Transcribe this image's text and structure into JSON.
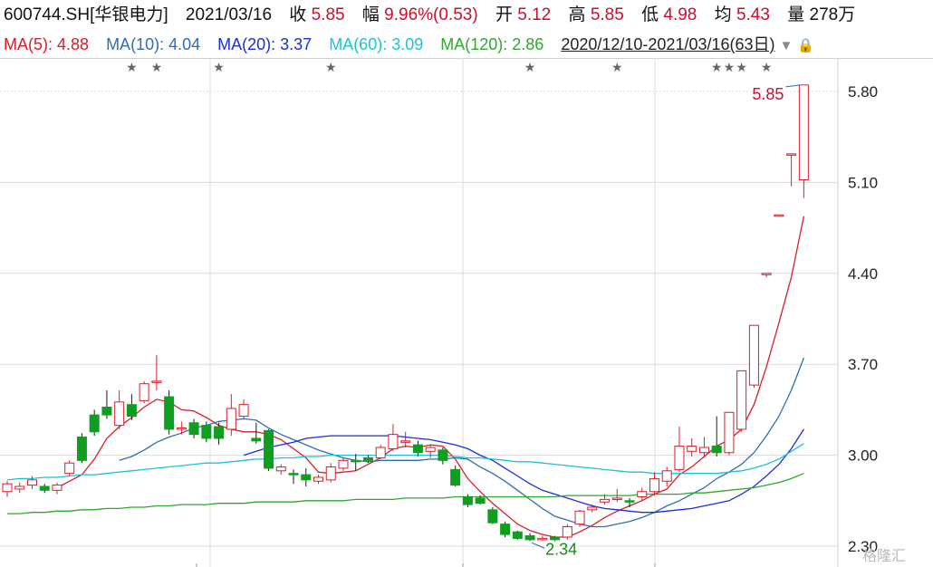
{
  "header": {
    "code": "600744.SH[华银电力]",
    "date": "2021/03/16",
    "close_label": "收",
    "close": "5.85",
    "change_label": "幅",
    "change": "9.96%(0.53)",
    "open_label": "开",
    "open": "5.12",
    "high_label": "高",
    "high": "5.85",
    "low_label": "低",
    "low": "4.98",
    "avg_label": "均",
    "avg": "5.43",
    "vol_label": "量",
    "vol": "278万"
  },
  "ma_bar": {
    "ma5": "MA(5): 4.88",
    "ma10": "MA(10): 4.04",
    "ma20": "MA(20): 3.37",
    "ma60": "MA(60): 3.09",
    "ma120": "MA(120): 2.86",
    "range": "2020/12/10-2021/03/16(63日)"
  },
  "watermark": "格隆汇",
  "colors": {
    "up": "#d81e2c",
    "down": "#0f9e20",
    "ma5": "#d81e2c",
    "ma10": "#2f6fb0",
    "ma20": "#1a2fd8",
    "ma60": "#1ec2d6",
    "ma120": "#2ea82e",
    "grid": "#dcdcdc"
  },
  "chart_data": {
    "type": "candlestick",
    "ylim": [
      2.3,
      5.8
    ],
    "y_ticks": [
      "5.80",
      "5.10",
      "4.40",
      "3.70",
      "3.00",
      "2.30"
    ],
    "annotations": {
      "high_label": "5.85",
      "low_label": "2.34"
    },
    "star_candles": [
      10,
      12,
      17,
      26,
      42,
      49,
      57,
      58,
      59,
      61
    ],
    "candles": [
      [
        2.72,
        2.78,
        2.68,
        2.8
      ],
      [
        2.74,
        2.76,
        2.71,
        2.79
      ],
      [
        2.77,
        2.81,
        2.74,
        2.84
      ],
      [
        2.76,
        2.73,
        2.71,
        2.78
      ],
      [
        2.73,
        2.77,
        2.7,
        2.79
      ],
      [
        2.86,
        2.94,
        2.84,
        2.96
      ],
      [
        3.14,
        2.96,
        2.94,
        3.17
      ],
      [
        3.31,
        3.18,
        3.15,
        3.35
      ],
      [
        3.37,
        3.31,
        3.28,
        3.5
      ],
      [
        3.23,
        3.41,
        3.2,
        3.5
      ],
      [
        3.39,
        3.3,
        3.27,
        3.47
      ],
      [
        3.42,
        3.55,
        3.4,
        3.57
      ],
      [
        3.56,
        3.57,
        3.5,
        3.77
      ],
      [
        3.45,
        3.2,
        3.16,
        3.5
      ],
      [
        3.2,
        3.21,
        3.16,
        3.26
      ],
      [
        3.25,
        3.16,
        3.13,
        3.28
      ],
      [
        3.23,
        3.13,
        3.1,
        3.26
      ],
      [
        3.22,
        3.13,
        3.08,
        3.25
      ],
      [
        3.2,
        3.36,
        3.15,
        3.47
      ],
      [
        3.3,
        3.39,
        3.28,
        3.43
      ],
      [
        3.13,
        3.11,
        3.09,
        3.25
      ],
      [
        3.19,
        2.9,
        2.88,
        3.2
      ],
      [
        2.88,
        2.91,
        2.85,
        2.93
      ],
      [
        2.86,
        2.85,
        2.78,
        2.89
      ],
      [
        2.85,
        2.81,
        2.76,
        2.9
      ],
      [
        2.8,
        2.83,
        2.78,
        2.85
      ],
      [
        2.81,
        2.91,
        2.79,
        2.94
      ],
      [
        2.9,
        2.96,
        2.88,
        2.98
      ],
      [
        2.96,
        2.95,
        2.88,
        3.01
      ],
      [
        2.98,
        2.96,
        2.94,
        3.0
      ],
      [
        2.98,
        3.06,
        2.97,
        3.08
      ],
      [
        3.05,
        3.16,
        3.03,
        3.24
      ],
      [
        3.1,
        3.11,
        3.06,
        3.18
      ],
      [
        3.08,
        3.02,
        2.99,
        3.11
      ],
      [
        3.03,
        3.06,
        2.98,
        3.08
      ],
      [
        3.04,
        2.96,
        2.93,
        3.06
      ],
      [
        2.89,
        2.77,
        2.76,
        2.92
      ],
      [
        2.68,
        2.62,
        2.6,
        2.7
      ],
      [
        2.67,
        2.63,
        2.62,
        2.69
      ],
      [
        2.58,
        2.48,
        2.47,
        2.6
      ],
      [
        2.47,
        2.39,
        2.37,
        2.49
      ],
      [
        2.41,
        2.36,
        2.35,
        2.42
      ],
      [
        2.38,
        2.35,
        2.34,
        2.4
      ],
      [
        2.35,
        2.36,
        2.34,
        2.38
      ],
      [
        2.37,
        2.35,
        2.34,
        2.38
      ],
      [
        2.37,
        2.45,
        2.35,
        2.47
      ],
      [
        2.47,
        2.57,
        2.45,
        2.58
      ],
      [
        2.58,
        2.6,
        2.56,
        2.62
      ],
      [
        2.64,
        2.66,
        2.62,
        2.7
      ],
      [
        2.66,
        2.67,
        2.64,
        2.74
      ],
      [
        2.65,
        2.64,
        2.6,
        2.67
      ],
      [
        2.68,
        2.72,
        2.65,
        2.75
      ],
      [
        2.72,
        2.82,
        2.69,
        2.87
      ],
      [
        2.8,
        2.88,
        2.76,
        2.91
      ],
      [
        2.89,
        3.07,
        2.87,
        3.22
      ],
      [
        3.03,
        3.07,
        2.99,
        3.13
      ],
      [
        3.02,
        3.06,
        2.98,
        3.14
      ],
      [
        3.07,
        3.02,
        2.99,
        3.3
      ],
      [
        3.02,
        3.33,
        3.0,
        3.33
      ],
      [
        3.2,
        3.65,
        3.18,
        3.65
      ],
      [
        3.54,
        4.0,
        3.52,
        4.0
      ],
      [
        4.4,
        4.4,
        4.37,
        4.4
      ],
      [
        4.85,
        4.85,
        4.84,
        4.85
      ],
      [
        5.32,
        5.32,
        5.07,
        5.32
      ],
      [
        5.12,
        5.85,
        4.98,
        5.85
      ]
    ],
    "series": [
      {
        "name": "MA(5)",
        "values": [
          null,
          null,
          null,
          null,
          2.75,
          2.8,
          2.85,
          2.97,
          3.13,
          3.22,
          3.29,
          3.37,
          3.43,
          3.41,
          3.35,
          3.34,
          3.29,
          3.23,
          3.2,
          3.18,
          3.18,
          3.16,
          3.12,
          3.05,
          2.98,
          2.87,
          2.86,
          2.87,
          2.88,
          2.93,
          2.98,
          3.05,
          3.07,
          3.06,
          3.08,
          3.07,
          2.97,
          2.82,
          2.72,
          2.63,
          2.55,
          2.47,
          2.42,
          2.39,
          2.37,
          2.37,
          2.41,
          2.46,
          2.52,
          2.57,
          2.61,
          2.65,
          2.7,
          2.74,
          2.85,
          2.91,
          2.99,
          3.07,
          3.12,
          3.2,
          3.39,
          3.68,
          4.02,
          4.37,
          4.84
        ]
      },
      {
        "name": "MA(10)",
        "values": [
          null,
          null,
          null,
          null,
          null,
          null,
          null,
          null,
          null,
          2.96,
          2.99,
          3.04,
          3.1,
          3.14,
          3.17,
          3.21,
          3.23,
          3.26,
          3.27,
          3.28,
          3.27,
          3.21,
          3.16,
          3.12,
          3.08,
          3.04,
          3.01,
          2.98,
          2.96,
          2.95,
          2.96,
          2.96,
          2.96,
          2.96,
          2.97,
          2.97,
          2.98,
          2.97,
          2.91,
          2.86,
          2.8,
          2.73,
          2.66,
          2.59,
          2.53,
          2.5,
          2.47,
          2.45,
          2.45,
          2.47,
          2.49,
          2.52,
          2.56,
          2.61,
          2.65,
          2.7,
          2.75,
          2.82,
          2.87,
          2.93,
          3.02,
          3.15,
          3.3,
          3.5,
          3.75
        ]
      },
      {
        "name": "MA(20)",
        "values": [
          null,
          null,
          null,
          null,
          null,
          null,
          null,
          null,
          null,
          null,
          null,
          null,
          null,
          null,
          null,
          null,
          null,
          null,
          null,
          3.0,
          3.03,
          3.06,
          3.08,
          3.1,
          3.13,
          3.14,
          3.15,
          3.15,
          3.15,
          3.15,
          3.15,
          3.15,
          3.14,
          3.13,
          3.12,
          3.1,
          3.08,
          3.05,
          3.0,
          2.96,
          2.9,
          2.84,
          2.78,
          2.73,
          2.7,
          2.67,
          2.64,
          2.61,
          2.59,
          2.58,
          2.57,
          2.56,
          2.56,
          2.57,
          2.58,
          2.59,
          2.61,
          2.63,
          2.65,
          2.7,
          2.76,
          2.84,
          2.93,
          3.05,
          3.2
        ]
      },
      {
        "name": "MA(60)",
        "values": [
          2.81,
          2.82,
          2.82,
          2.83,
          2.83,
          2.84,
          2.85,
          2.85,
          2.86,
          2.87,
          2.88,
          2.89,
          2.9,
          2.91,
          2.92,
          2.93,
          2.94,
          2.94,
          2.95,
          2.96,
          2.97,
          2.97,
          2.98,
          2.98,
          2.99,
          2.99,
          3.0,
          3.0,
          3.0,
          3.0,
          3.0,
          3.0,
          3.0,
          3.0,
          3.0,
          3.0,
          2.99,
          2.98,
          2.98,
          2.97,
          2.96,
          2.95,
          2.95,
          2.94,
          2.93,
          2.92,
          2.91,
          2.9,
          2.89,
          2.88,
          2.87,
          2.87,
          2.86,
          2.86,
          2.86,
          2.86,
          2.86,
          2.86,
          2.87,
          2.88,
          2.9,
          2.93,
          2.97,
          3.03,
          3.09
        ]
      },
      {
        "name": "MA(120)",
        "values": [
          2.55,
          2.55,
          2.56,
          2.56,
          2.57,
          2.57,
          2.58,
          2.58,
          2.59,
          2.59,
          2.6,
          2.6,
          2.61,
          2.61,
          2.62,
          2.62,
          2.62,
          2.63,
          2.63,
          2.63,
          2.64,
          2.64,
          2.64,
          2.64,
          2.65,
          2.65,
          2.65,
          2.65,
          2.66,
          2.66,
          2.66,
          2.66,
          2.67,
          2.67,
          2.67,
          2.67,
          2.68,
          2.68,
          2.68,
          2.68,
          2.68,
          2.68,
          2.68,
          2.68,
          2.68,
          2.69,
          2.69,
          2.69,
          2.69,
          2.69,
          2.69,
          2.7,
          2.7,
          2.7,
          2.7,
          2.71,
          2.71,
          2.72,
          2.73,
          2.74,
          2.75,
          2.77,
          2.79,
          2.82,
          2.86
        ]
      }
    ]
  }
}
